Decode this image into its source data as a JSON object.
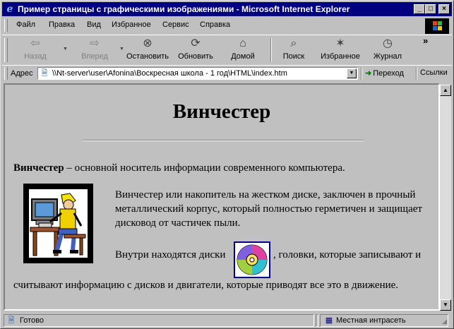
{
  "window": {
    "title": "Пример страницы с графическими изображениями - Microsoft Internet Explorer",
    "minimize": "_",
    "maximize": "□",
    "close": "×"
  },
  "menu": {
    "items": [
      {
        "label": "Файл"
      },
      {
        "label": "Правка"
      },
      {
        "label": "Вид"
      },
      {
        "label": "Избранное"
      },
      {
        "label": "Сервис"
      },
      {
        "label": "Справка"
      }
    ]
  },
  "toolbar": {
    "back": {
      "label": "Назад",
      "icon": "back-arrow-icon",
      "glyph": "⇦",
      "enabled": false
    },
    "forward": {
      "label": "Вперед",
      "icon": "forward-arrow-icon",
      "glyph": "⇨",
      "enabled": false
    },
    "stop": {
      "label": "Остановить",
      "icon": "stop-icon",
      "glyph": "⊗"
    },
    "refresh": {
      "label": "Обновить",
      "icon": "refresh-icon",
      "glyph": "⟳"
    },
    "home": {
      "label": "Домой",
      "icon": "home-icon",
      "glyph": "⌂"
    },
    "search": {
      "label": "Поиск",
      "icon": "search-icon",
      "glyph": "⌕"
    },
    "favorites": {
      "label": "Избранное",
      "icon": "favorites-icon",
      "glyph": "✶"
    },
    "history": {
      "label": "Журнал",
      "icon": "history-icon",
      "glyph": "◷"
    },
    "more": "»"
  },
  "address": {
    "label": "Адрес",
    "url": "\\\\Nt-server\\user\\Afonina\\Воскресная школа - 1 год\\HTML\\index.htm",
    "go_label": "Переход",
    "links_label": "Ссылки"
  },
  "page": {
    "heading": "Винчестер",
    "intro_bold": "Винчестер",
    "intro_rest": " – основной носитель информации современного компьютера.",
    "para2": "Винчестер или накопитель на жестком диске, заключен в прочный металлический корпус, который полностью герметичен и защищает дисковод от частичек пыли.",
    "para3_before": "Внутри находятся диски",
    "para3_after": ", головки, которые записывают и",
    "para3_cont": "считывают информацию с дисков и двигатели, которые приводят все это в движение."
  },
  "status": {
    "text": "Готово",
    "zone": "Местная интрасеть"
  },
  "colors": {
    "titlebar": "#000080",
    "face": "#c0c0c0"
  }
}
